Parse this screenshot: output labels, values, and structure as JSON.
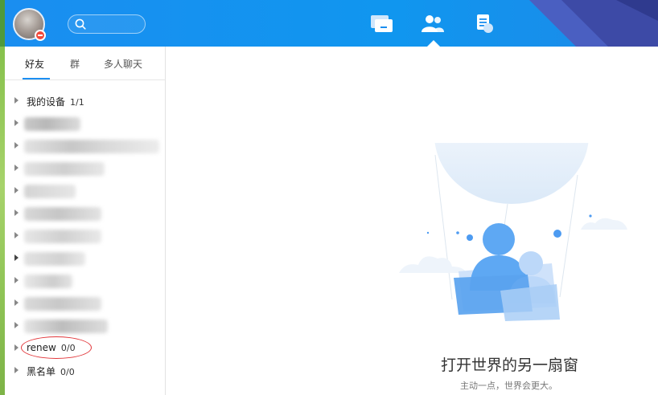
{
  "header": {
    "search": {
      "placeholder": ""
    },
    "nav": [
      {
        "icon": "message-icon"
      },
      {
        "icon": "contacts-icon"
      },
      {
        "icon": "notes-icon"
      }
    ],
    "active_nav": "contacts-icon",
    "colors": {
      "bar": "#1a8ef0",
      "corner_dark": "#3b4aa3",
      "corner_mid": "#4a62c3"
    }
  },
  "sidebar": {
    "tabs": [
      {
        "label": "好友",
        "active": true
      },
      {
        "label": "群",
        "active": false
      },
      {
        "label": "多人聊天",
        "active": false
      }
    ],
    "groups": [
      {
        "name": "我的设备",
        "count": "1/1",
        "blurred": false
      },
      {
        "name": "",
        "count": "",
        "blurred": true
      },
      {
        "name": "",
        "count": "",
        "blurred": true
      },
      {
        "name": "",
        "count": "",
        "blurred": true
      },
      {
        "name": "",
        "count": "",
        "blurred": true
      },
      {
        "name": "",
        "count": "",
        "blurred": true
      },
      {
        "name": "",
        "count": "",
        "blurred": true
      },
      {
        "name": "",
        "count": "",
        "blurred": true
      },
      {
        "name": "",
        "count": "",
        "blurred": true
      },
      {
        "name": "",
        "count": "",
        "blurred": true
      },
      {
        "name": "",
        "count": "",
        "blurred": true
      },
      {
        "name": "renew",
        "count": "0/0",
        "blurred": false
      },
      {
        "name": "黑名单",
        "count": "0/0",
        "blurred": false
      }
    ],
    "accent": "#1b8ef2",
    "annotation_color": "#e2363a"
  },
  "main": {
    "title": "打开世界的另一扇窗",
    "subtitle": "主动一点，世界会更大。"
  }
}
